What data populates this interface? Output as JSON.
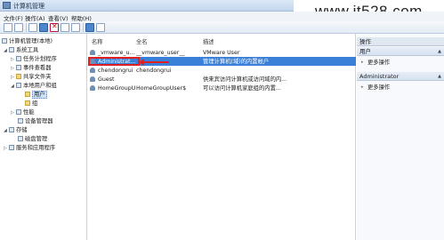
{
  "window": {
    "title": "计算机管理"
  },
  "watermark": "www.it528.com",
  "menu": [
    "文件(F)",
    "操作(A)",
    "查看(V)",
    "帮助(H)"
  ],
  "tree": {
    "root": "计算机管理(本地)",
    "system_tools": "系统工具",
    "task_scheduler": "任务计划程序",
    "event_viewer": "事件查看器",
    "shared_folders": "共享文件夹",
    "local_users_groups": "本地用户和组",
    "users": "用户",
    "groups": "组",
    "performance": "性能",
    "device_manager": "设备管理器",
    "storage": "存储",
    "disk_management": "磁盘管理",
    "services_apps": "服务和应用程序"
  },
  "list": {
    "columns": [
      "名称",
      "全名",
      "描述"
    ],
    "rows": [
      {
        "name": "_vmware_u...",
        "full_name": "__vmware_user__",
        "description": "VMware User"
      },
      {
        "name": "Administrat...",
        "full_name": "",
        "description": "管理计算机(域)的内置帐户"
      },
      {
        "name": "chendongrui",
        "full_name": "chendongrui",
        "description": ""
      },
      {
        "name": "Guest",
        "full_name": "",
        "description": "供来宾访问计算机或访问域的内..."
      },
      {
        "name": "HomeGroupU...",
        "full_name": "HomeGroupUser$",
        "description": "可以访问计算机家庭组的内置..."
      }
    ]
  },
  "actions": {
    "title": "操作",
    "section1": "用户",
    "more1": "更多操作",
    "section2": "Administrator",
    "more2": "更多操作"
  }
}
